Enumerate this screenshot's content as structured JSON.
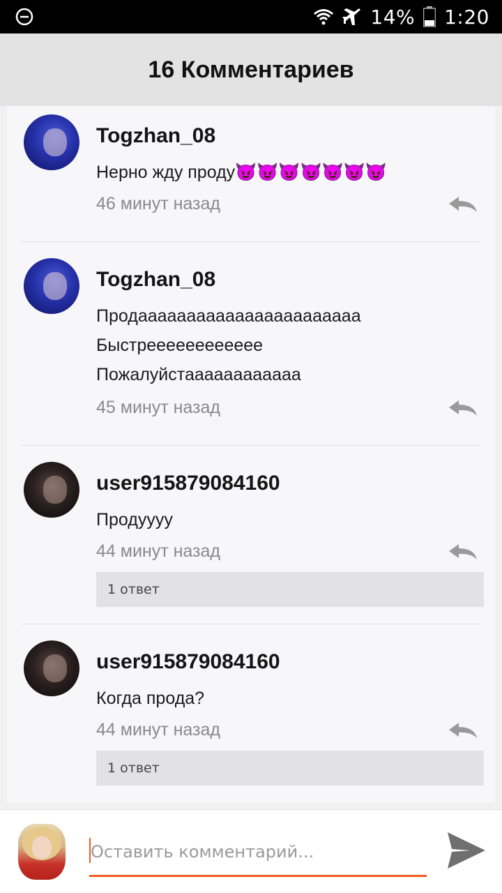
{
  "status_bar": {
    "battery": "14%",
    "time": "1:20"
  },
  "header": {
    "title": "16 Комментариев"
  },
  "comments": [
    {
      "username": "Togzhan_08",
      "text_lines": [
        "Нерно жду проду😈😈😈😈😈😈😈"
      ],
      "time": "46 минут назад",
      "replies": null,
      "avatar": "blue-portrait"
    },
    {
      "username": "Togzhan_08",
      "text_lines": [
        "Продааааааааааааааааааааааа",
        "Быстрееееееееееее",
        "Пожалуйстаааааааааааа"
      ],
      "time": "45 минут назад",
      "replies": null,
      "avatar": "blue-portrait"
    },
    {
      "username": "user915879084160",
      "text_lines": [
        "Продуууу"
      ],
      "time": "44 минут назад",
      "replies": "1 ответ",
      "avatar": "dark-portrait"
    },
    {
      "username": "user915879084160",
      "text_lines": [
        "Когда прода?"
      ],
      "time": "44 минут назад",
      "replies": "1 ответ",
      "avatar": "dark-portrait"
    }
  ],
  "composer": {
    "placeholder": "Оставить комментарий...",
    "accent_color": "#f05a1e"
  }
}
